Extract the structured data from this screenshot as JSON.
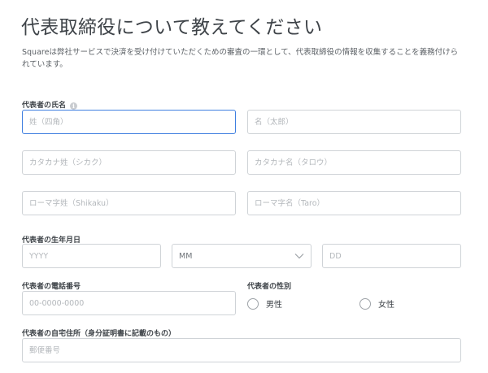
{
  "title": "代表取締役について教えてください",
  "description": "Squareは弊社サービスで決済を受け付けていただくための審査の一環として、代表取締役の情報を収集することを義務付けられています。",
  "name_section": {
    "label": "代表者の氏名",
    "info_icon": "info-icon",
    "last_name_placeholder": "姓（四角）",
    "first_name_placeholder": "名（太郎）",
    "last_kana_placeholder": "カタカナ姓（シカク）",
    "first_kana_placeholder": "カタカナ名（タロウ）",
    "last_roman_placeholder": "ローマ字姓（Shikaku）",
    "first_roman_placeholder": "ローマ字名（Taro）"
  },
  "birthdate_section": {
    "label": "代表者の生年月日",
    "year_placeholder": "YYYY",
    "month_value": "MM",
    "day_placeholder": "DD"
  },
  "phone_section": {
    "label": "代表者の電話番号",
    "placeholder": "00-0000-0000"
  },
  "gender_section": {
    "label": "代表者の性別",
    "options": [
      "男性",
      "女性"
    ]
  },
  "address_section": {
    "label": "代表者の自宅住所（身分証明書に記載のもの）",
    "postal_placeholder": "郵便番号"
  },
  "colors": {
    "focus_border": "#3f7fe0",
    "input_border": "#cfd3d7",
    "text": "#3e4348",
    "placeholder": "#b3b7bb"
  }
}
